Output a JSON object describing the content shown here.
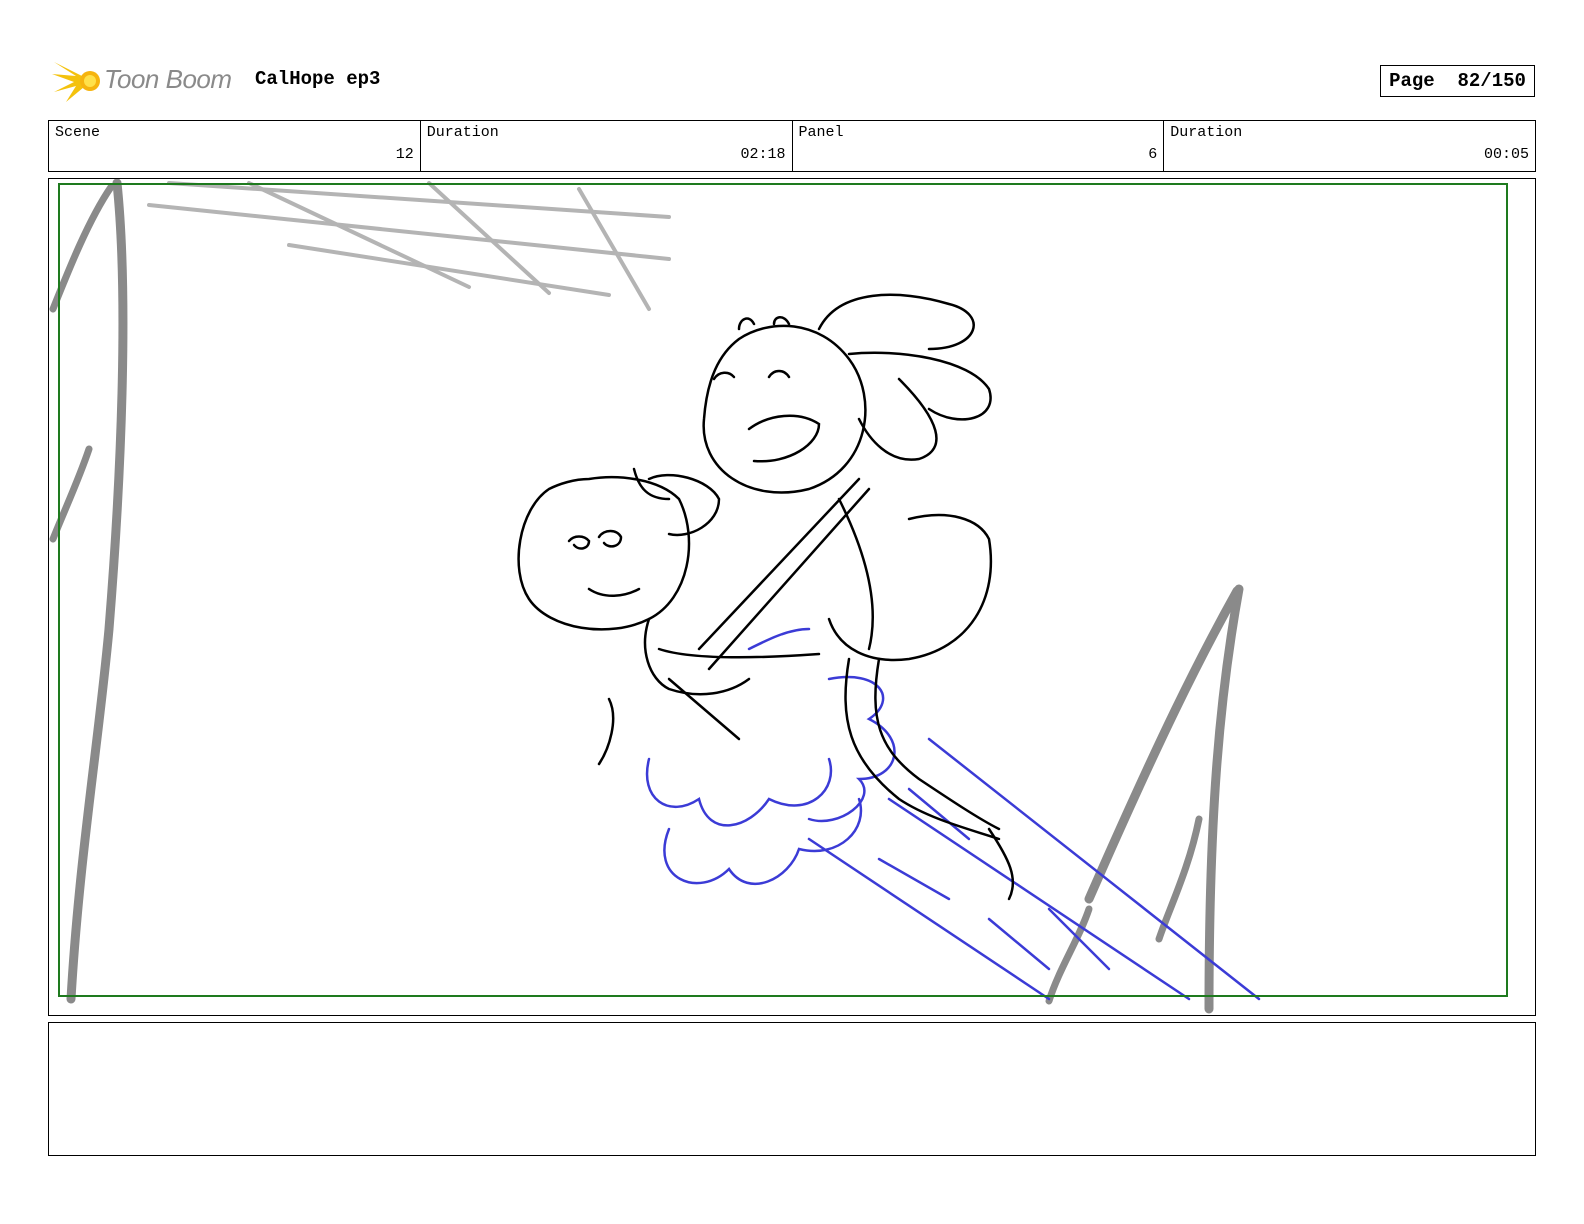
{
  "header": {
    "logo_text": "Toon Boom",
    "project_title": "CalHope ep3",
    "page_label": "Page",
    "page_number": "82/150"
  },
  "info": [
    {
      "label": "Scene",
      "value": "12"
    },
    {
      "label": "Duration",
      "value": "02:18"
    },
    {
      "label": "Panel",
      "value": "6"
    },
    {
      "label": "Duration",
      "value": "00:05"
    }
  ],
  "panel": {
    "safe_frame_color": "#1e7a1e",
    "ink_color": "#000000",
    "effects_color": "#3b3bd6",
    "background_sketch_color": "#8a8a8a"
  },
  "notes": ""
}
